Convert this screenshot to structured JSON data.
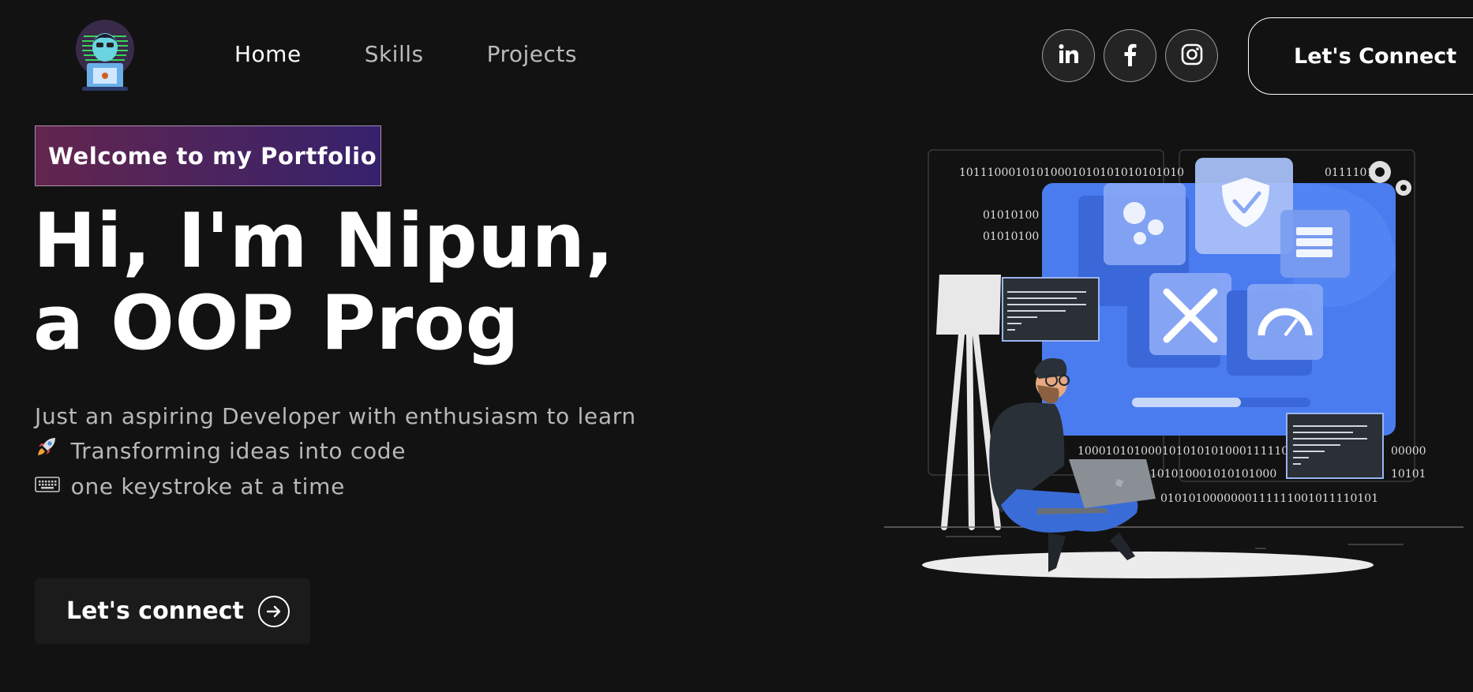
{
  "nav": {
    "links": [
      {
        "label": "Home"
      },
      {
        "label": "Skills"
      },
      {
        "label": "Projects"
      }
    ],
    "social": [
      {
        "icon": "linkedin-icon",
        "label": "in"
      },
      {
        "icon": "facebook-icon",
        "label": "f"
      },
      {
        "icon": "instagram-icon",
        "label": ""
      }
    ],
    "connect_label": "Let's Connect"
  },
  "hero": {
    "tagline": "Welcome to my Portfolio",
    "title": "Hi, I'm Nipun, a OOP Prog",
    "lines": [
      {
        "emoji": "",
        "text": "Just an aspiring Developer with enthusiasm to learn"
      },
      {
        "emoji": "🚀",
        "text": "Transforming ideas into code"
      },
      {
        "emoji": "⌨",
        "text": "one keystroke at a time"
      }
    ],
    "cta_label": "Let's connect"
  },
  "illustration": {
    "binary_lines": [
      "10111000101010001010101010101010",
      "01010100",
      "01010100",
      "011110101",
      "100010101000101010101000111110",
      "00000",
      "0101010001010101000",
      "10101",
      "0101010000000111111001011110101"
    ]
  },
  "colors": {
    "background": "#121212",
    "accent_blue": "#4a7cf0",
    "tagline_gradient_start": "#aa367c",
    "tagline_gradient_end": "#4a2fbd"
  }
}
